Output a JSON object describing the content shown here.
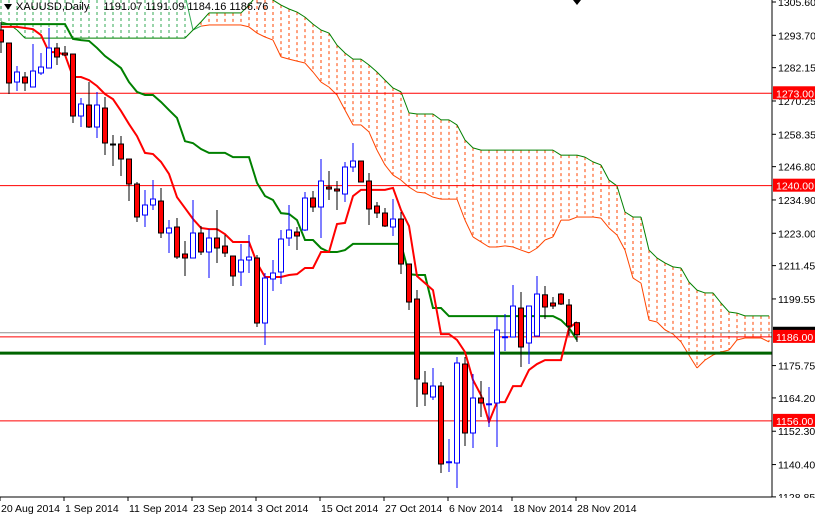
{
  "header": {
    "symbol": "XAUUSD,Daily",
    "ohlc": "1191.07 1191.09 1184.16 1186.76"
  },
  "colors": {
    "bull": "#0000ff",
    "bear": "#ff0000",
    "tenkan": "#ff0000",
    "kijun": "#008000",
    "cloud_bull": "#33aa55",
    "cloud_bear": "#ff4500",
    "level_line": "#ff0000",
    "support_line": "#006400",
    "bid_line": "#909090"
  },
  "chart_data": {
    "type": "candlestick",
    "title": "XAUUSD,Daily",
    "ylim": [
      1128.85,
      1305.6
    ],
    "bar_count_with_projection": 97,
    "y_ticks": [
      "1305.60",
      "1293.70",
      "1282.15",
      "1270.25",
      "1258.35",
      "1246.80",
      "1234.90",
      "1223.00",
      "1211.45",
      "1199.55",
      "1175.75",
      "1164.20",
      "1152.30",
      "1140.40",
      "1128.85"
    ],
    "x_ticks": [
      {
        "bar": 0,
        "label": "20 Aug 2014"
      },
      {
        "bar": 8,
        "label": "1 Sep 2014"
      },
      {
        "bar": 16,
        "label": "11 Sep 2014"
      },
      {
        "bar": 24,
        "label": "23 Sep 2014"
      },
      {
        "bar": 32,
        "label": "3 Oct 2014"
      },
      {
        "bar": 40,
        "label": "15 Oct 2014"
      },
      {
        "bar": 48,
        "label": "27 Oct 2014"
      },
      {
        "bar": 56,
        "label": "6 Nov 2014"
      },
      {
        "bar": 64,
        "label": "18 Nov 2014"
      },
      {
        "bar": 72,
        "label": "28 Nov 2014"
      }
    ],
    "levels": [
      {
        "price": 1273.0,
        "label": "1273.00",
        "kind": "resistance"
      },
      {
        "price": 1240.0,
        "label": "1240.00",
        "kind": "resistance"
      },
      {
        "price": 1186.0,
        "label": "1186.00",
        "kind": "pivot"
      },
      {
        "price": 1156.0,
        "label": "1156.00",
        "kind": "support"
      }
    ],
    "support_band_price": 1180.2,
    "bid_price": 1186.76,
    "candles_ohlc": [
      [
        1295.6,
        1298.45,
        1287.38,
        1291.31
      ],
      [
        1290.95,
        1290.95,
        1272.74,
        1276.67
      ],
      [
        1277.02,
        1282.74,
        1273.81,
        1280.6
      ],
      [
        1278.81,
        1280.6,
        1273.81,
        1276.67
      ],
      [
        1275.24,
        1290.6,
        1275.24,
        1280.95
      ],
      [
        1280.24,
        1287.38,
        1279.52,
        1282.38
      ],
      [
        1282.02,
        1296.31,
        1282.02,
        1289.17
      ],
      [
        1289.17,
        1290.95,
        1283.1,
        1285.95
      ],
      [
        1287.38,
        1289.88,
        1286.31,
        1286.67
      ],
      [
        1287.02,
        1287.02,
        1262.38,
        1264.88
      ],
      [
        1264.88,
        1271.31,
        1260.95,
        1269.17
      ],
      [
        1268.81,
        1277.02,
        1260.6,
        1260.95
      ],
      [
        1260.95,
        1273.45,
        1257.02,
        1268.81
      ],
      [
        1267.74,
        1271.67,
        1250.95,
        1255.24
      ],
      [
        1254.88,
        1258.1,
        1247.02,
        1254.8
      ],
      [
        1254.88,
        1257.74,
        1243.45,
        1249.52
      ],
      [
        1249.52,
        1249.52,
        1234.52,
        1240.6
      ],
      [
        1240.6,
        1241.31,
        1227.02,
        1228.81
      ],
      [
        1229.52,
        1238.45,
        1225.24,
        1233.1
      ],
      [
        1233.1,
        1242.02,
        1231.31,
        1235.24
      ],
      [
        1234.52,
        1239.17,
        1221.31,
        1223.1
      ],
      [
        1223.1,
        1227.74,
        1215.95,
        1224.88
      ],
      [
        1225.24,
        1228.45,
        1213.81,
        1214.52
      ],
      [
        1215.6,
        1220.24,
        1207.74,
        1214.17
      ],
      [
        1214.17,
        1234.88,
        1214.17,
        1223.1
      ],
      [
        1223.1,
        1225.6,
        1215.24,
        1216.31
      ],
      [
        1216.31,
        1224.52,
        1207.02,
        1221.31
      ],
      [
        1221.31,
        1231.31,
        1212.38,
        1217.74
      ],
      [
        1218.45,
        1222.38,
        1214.52,
        1215.95
      ],
      [
        1214.88,
        1214.88,
        1204.17,
        1207.74
      ],
      [
        1209.17,
        1219.17,
        1204.17,
        1213.45
      ],
      [
        1213.45,
        1222.38,
        1208.81,
        1214.52
      ],
      [
        1214.17,
        1215.24,
        1189.52,
        1190.95
      ],
      [
        1190.95,
        1208.81,
        1183.1,
        1207.02
      ],
      [
        1206.67,
        1213.45,
        1202.38,
        1208.81
      ],
      [
        1209.17,
        1224.17,
        1204.88,
        1220.95
      ],
      [
        1221.31,
        1233.1,
        1218.45,
        1224.17
      ],
      [
        1223.45,
        1225.24,
        1217.02,
        1222.02
      ],
      [
        1224.17,
        1237.74,
        1223.81,
        1235.6
      ],
      [
        1235.6,
        1238.1,
        1230.6,
        1232.38
      ],
      [
        1232.38,
        1249.52,
        1221.31,
        1241.67
      ],
      [
        1239.52,
        1245.24,
        1234.88,
        1238.81
      ],
      [
        1238.81,
        1241.67,
        1231.31,
        1238.1
      ],
      [
        1237.02,
        1248.45,
        1234.17,
        1246.67
      ],
      [
        1246.67,
        1255.24,
        1244.88,
        1248.81
      ],
      [
        1248.81,
        1248.81,
        1241.31,
        1241.31
      ],
      [
        1241.67,
        1244.52,
        1225.95,
        1231.67
      ],
      [
        1232.74,
        1234.17,
        1228.45,
        1230.24
      ],
      [
        1230.24,
        1232.02,
        1225.24,
        1225.6
      ],
      [
        1225.24,
        1235.24,
        1222.02,
        1228.1
      ],
      [
        1228.1,
        1230.6,
        1208.45,
        1212.02
      ],
      [
        1212.02,
        1212.02,
        1195.6,
        1198.45
      ],
      [
        1199.52,
        1202.74,
        1160.95,
        1170.95
      ],
      [
        1169.52,
        1173.81,
        1161.31,
        1165.6
      ],
      [
        1164.52,
        1174.88,
        1163.45,
        1168.45
      ],
      [
        1168.45,
        1169.88,
        1137.38,
        1140.6
      ],
      [
        1141.31,
        1149.52,
        1137.74,
        1141.4
      ],
      [
        1140.95,
        1178.81,
        1132.02,
        1176.67
      ],
      [
        1176.31,
        1178.81,
        1147.02,
        1151.67
      ],
      [
        1151.67,
        1172.74,
        1146.31,
        1164.17
      ],
      [
        1164.17,
        1170.24,
        1157.38,
        1162.38
      ],
      [
        1162.02,
        1168.1,
        1153.81,
        1162.1
      ],
      [
        1162.38,
        1193.1,
        1146.67,
        1188.45
      ],
      [
        1185.95,
        1194.17,
        1180.95,
        1186.05
      ],
      [
        1185.95,
        1204.52,
        1185.95,
        1197.02
      ],
      [
        1196.31,
        1202.02,
        1175.24,
        1182.38
      ],
      [
        1183.81,
        1197.02,
        1176.31,
        1197.02
      ],
      [
        1186.31,
        1207.74,
        1186.31,
        1201.31
      ],
      [
        1201.02,
        1204.17,
        1192.38,
        1196.67
      ],
      [
        1198.1,
        1200.24,
        1195.95,
        1197.02
      ],
      [
        1201.31,
        1201.67,
        1197.38,
        1197.74
      ],
      [
        1197.38,
        1199.52,
        1186.31,
        1189.88
      ],
      [
        1191.07,
        1191.09,
        1184.16,
        1186.76
      ]
    ],
    "tenkan_sen": [
      1296.7,
      1296.7,
      1296.7,
      1296.3,
      1295.9,
      1293.8,
      1287.7,
      1287.7,
      1286.7,
      1278.8,
      1278.8,
      1277.7,
      1275.6,
      1272.7,
      1270.9,
      1266.7,
      1262.0,
      1257.7,
      1251.7,
      1251.3,
      1248.5,
      1244.2,
      1235.9,
      1232.0,
      1228.1,
      1224.9,
      1224.5,
      1224.5,
      1222.7,
      1219.9,
      1219.9,
      1219.9,
      1212.4,
      1207.4,
      1207.4,
      1207.4,
      1208.1,
      1208.4,
      1210.6,
      1210.6,
      1216.3,
      1216.3,
      1226.3,
      1226.7,
      1236.3,
      1238.5,
      1238.5,
      1238.5,
      1238.5,
      1239.2,
      1231.3,
      1225.6,
      1207.7,
      1205.2,
      1202.7,
      1187.0,
      1187.0,
      1184.9,
      1180.6,
      1170.6,
      1165.2,
      1155.6,
      1162.7,
      1162.7,
      1168.4,
      1168.4,
      1174.2,
      1176.3,
      1177.7,
      1177.7,
      1177.7,
      1189.2,
      1191.3
    ],
    "kijun_sen": [
      1297.7,
      1297.7,
      1297.7,
      1297.7,
      1297.7,
      1297.7,
      1297.7,
      1297.7,
      1297.7,
      1292.4,
      1292.0,
      1291.7,
      1289.2,
      1286.3,
      1284.2,
      1282.0,
      1277.0,
      1273.5,
      1272.4,
      1272.4,
      1269.9,
      1267.0,
      1264.2,
      1255.9,
      1255.2,
      1253.1,
      1251.7,
      1251.7,
      1251.7,
      1250.2,
      1250.2,
      1250.2,
      1241.0,
      1236.3,
      1234.9,
      1230.2,
      1229.9,
      1227.7,
      1220.6,
      1220.6,
      1217.7,
      1216.3,
      1216.3,
      1217.0,
      1219.2,
      1219.2,
      1219.2,
      1219.2,
      1219.2,
      1219.2,
      1219.2,
      1208.4,
      1208.1,
      1208.1,
      1196.3,
      1196.3,
      1193.4,
      1193.4,
      1193.4,
      1193.4,
      1193.4,
      1193.4,
      1193.4,
      1193.4,
      1193.4,
      1193.4,
      1193.4,
      1193.4,
      1193.4,
      1193.4,
      1192.0,
      1189.2,
      1184.9
    ],
    "senkou_span_a": [
      1308.1,
      1308.1,
      1308.1,
      1308.1,
      1308.1,
      1308.1,
      1308.1,
      1308.1,
      1308.1,
      1308.1,
      1308.1,
      1308.1,
      1308.1,
      1308.1,
      1308.1,
      1308.1,
      1308.1,
      1308.1,
      1308.1,
      1308.1,
      1308.1,
      1308.1,
      1308.1,
      1308.1,
      1295.6,
      1297.0,
      1297.4,
      1297.4,
      1297.4,
      1297.4,
      1297.4,
      1296.7,
      1294.5,
      1293.1,
      1292.0,
      1286.0,
      1285.2,
      1284.5,
      1283.8,
      1280.6,
      1277.0,
      1275.2,
      1272.4,
      1267.0,
      1261.7,
      1261.7,
      1259.2,
      1252.7,
      1247.4,
      1243.8,
      1242.0,
      1239.5,
      1237.7,
      1237.4,
      1235.9,
      1235.2,
      1235.2,
      1235.2,
      1227.7,
      1221.7,
      1219.9,
      1218.1,
      1218.1,
      1218.5,
      1218.1,
      1217.0,
      1216.0,
      1217.7,
      1220.6,
      1221.7,
      1227.7,
      1227.7,
      1228.8,
      1228.8,
      1228.8,
      1228.4,
      1224.9,
      1222.4,
      1217.0,
      1207.0,
      1205.2,
      1192.0,
      1191.3,
      1188.5,
      1187.0,
      1184.2,
      1179.5,
      1174.9,
      1177.7,
      1179.5,
      1180.6,
      1181.3,
      1184.9,
      1185.6,
      1185.6,
      1185.6,
      1184.2
    ],
    "senkou_span_b": [
      1298.5,
      1297.7,
      1295.6,
      1292.7,
      1292.7,
      1292.7,
      1292.7,
      1292.7,
      1292.7,
      1292.7,
      1292.7,
      1292.7,
      1292.7,
      1292.7,
      1292.7,
      1292.7,
      1292.7,
      1292.7,
      1292.7,
      1292.7,
      1292.7,
      1292.7,
      1292.7,
      1292.7,
      1295.6,
      1298.5,
      1301.7,
      1301.7,
      1301.7,
      1301.7,
      1301.7,
      1304.5,
      1308.1,
      1308.1,
      1306.3,
      1304.5,
      1303.1,
      1302.0,
      1300.2,
      1297.7,
      1295.6,
      1294.5,
      1290.2,
      1287.4,
      1285.2,
      1285.2,
      1283.1,
      1280.6,
      1277.7,
      1274.9,
      1273.5,
      1266.0,
      1265.6,
      1265.6,
      1265.6,
      1263.5,
      1263.5,
      1261.7,
      1256.3,
      1253.5,
      1252.7,
      1252.7,
      1252.7,
      1252.7,
      1252.7,
      1252.7,
      1252.7,
      1252.7,
      1252.7,
      1252.7,
      1250.9,
      1250.9,
      1250.9,
      1250.2,
      1248.5,
      1247.4,
      1242.0,
      1239.9,
      1230.6,
      1228.8,
      1228.8,
      1217.0,
      1214.2,
      1212.4,
      1211.0,
      1210.6,
      1205.6,
      1202.7,
      1201.7,
      1201.7,
      1198.1,
      1194.9,
      1194.5,
      1193.5,
      1193.5,
      1193.5,
      1193.5
    ]
  }
}
